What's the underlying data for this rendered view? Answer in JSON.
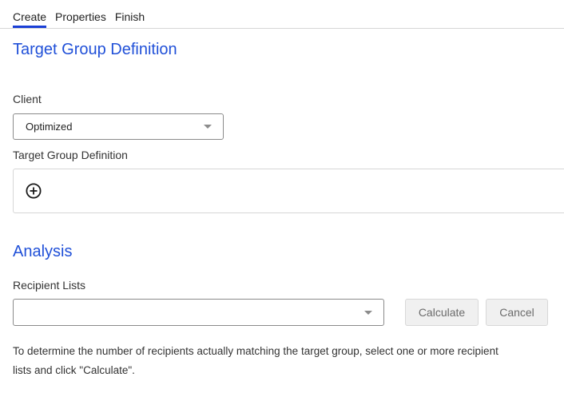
{
  "tabs": [
    {
      "label": "Create",
      "active": true
    },
    {
      "label": "Properties",
      "active": false
    },
    {
      "label": "Finish",
      "active": false
    }
  ],
  "definition_section": {
    "title": "Target Group Definition",
    "client_label": "Client",
    "client_value": "Optimized",
    "tgd_label": "Target Group Definition",
    "add_icon": "plus-circle-icon"
  },
  "analysis_section": {
    "title": "Analysis",
    "recipient_lists_label": "Recipient Lists",
    "recipient_lists_value": "",
    "calculate_label": "Calculate",
    "cancel_label": "Cancel",
    "help_text": "To determine the number of recipients actually matching the target group, select one or more recipient lists and click \"Calculate\"."
  },
  "colors": {
    "accent": "#2050d8",
    "tab_underline": "#1a3fd6"
  }
}
